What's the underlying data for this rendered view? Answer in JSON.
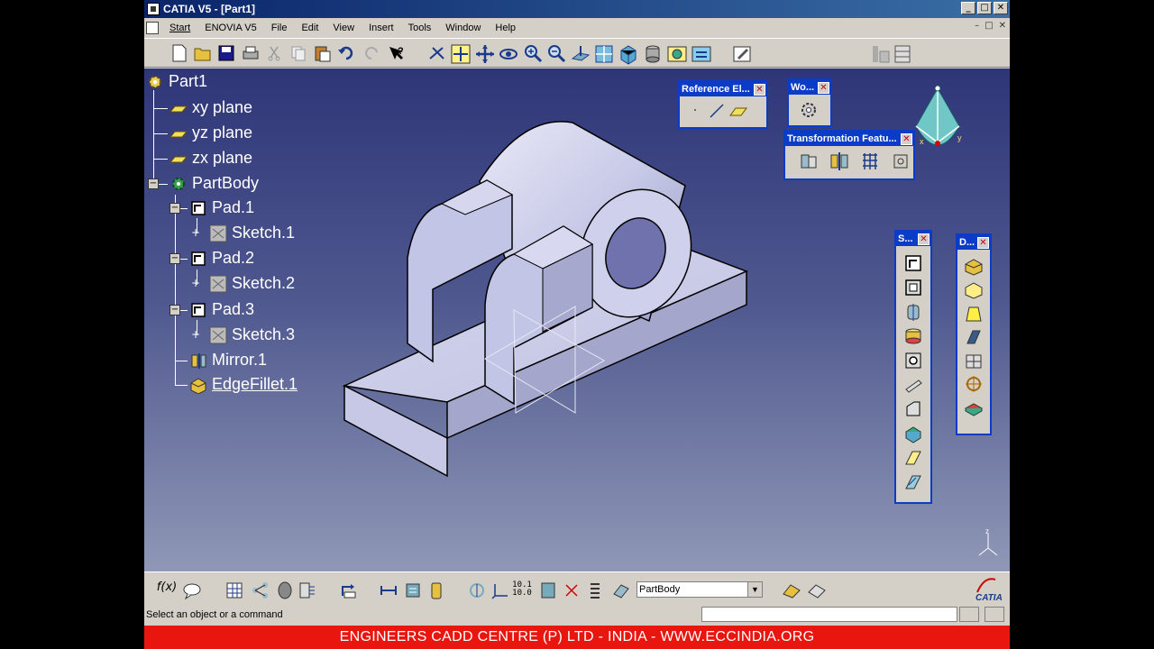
{
  "window": {
    "title": "CATIA V5 - [Part1]",
    "controls": [
      "_",
      "□",
      "✕"
    ]
  },
  "menu": {
    "items": [
      "Start",
      "ENOVIA V5",
      "File",
      "Edit",
      "View",
      "Insert",
      "Tools",
      "Window",
      "Help"
    ],
    "mdi_controls": [
      "–",
      "□",
      "✕"
    ]
  },
  "tree": {
    "root": "Part1",
    "nodes": [
      {
        "label": "xy plane",
        "icon": "plane-icon"
      },
      {
        "label": "yz plane",
        "icon": "plane-icon"
      },
      {
        "label": "zx plane",
        "icon": "plane-icon"
      },
      {
        "label": "PartBody",
        "icon": "gear-icon"
      },
      {
        "label": "Pad.1",
        "icon": "pad-icon"
      },
      {
        "label": "Sketch.1",
        "icon": "sketch-icon"
      },
      {
        "label": "Pad.2",
        "icon": "pad-icon"
      },
      {
        "label": "Sketch.2",
        "icon": "sketch-icon"
      },
      {
        "label": "Pad.3",
        "icon": "pad-icon"
      },
      {
        "label": "Sketch.3",
        "icon": "sketch-icon"
      },
      {
        "label": "Mirror.1",
        "icon": "mirror-icon"
      },
      {
        "label": "EdgeFillet.1",
        "icon": "fillet-icon"
      }
    ]
  },
  "floating_toolbars": {
    "reference": {
      "title": "Reference El..."
    },
    "workbench": {
      "title": "Wo..."
    },
    "transformation": {
      "title": "Transformation Featu..."
    },
    "sketch_based": {
      "title": "S..."
    },
    "dress_up": {
      "title": "D..."
    }
  },
  "bottom": {
    "body_select": "PartBody",
    "tick_label": "10.1\n10.0"
  },
  "status": {
    "message": "Select an object or a command"
  },
  "banner": {
    "text": "ENGINEERS CADD CENTRE (P) LTD - INDIA - WWW.ECCINDIA.ORG"
  },
  "compass": {
    "axes": [
      "x",
      "y",
      "z"
    ]
  },
  "colors": {
    "viewport_top": "#2e3678",
    "viewport_bottom": "#8f98b6",
    "part_face": "#c4c6e8",
    "title_bar": "#0a246a",
    "banner": "#e8160e"
  }
}
